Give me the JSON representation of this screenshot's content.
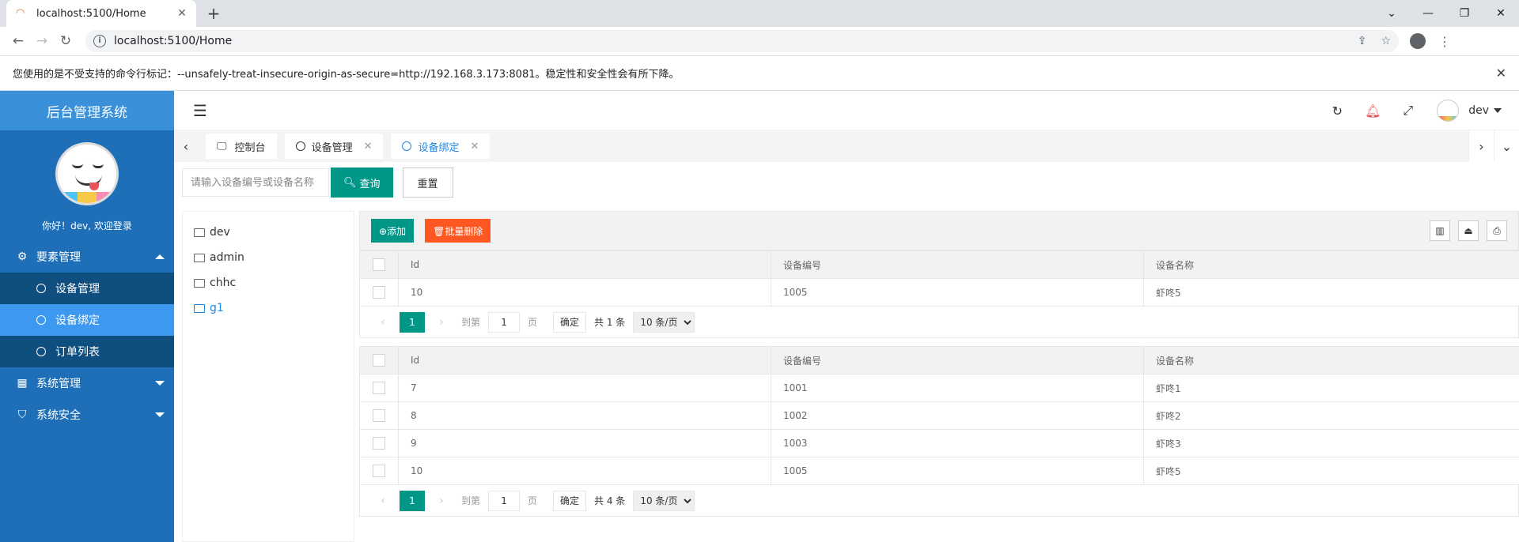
{
  "browser": {
    "tab_title": "localhost:5100/Home",
    "url": "localhost:5100/Home",
    "infobar_message": "您使用的是不受支持的命令行标记：--unsafely-treat-insecure-origin-as-secure=http://192.168.3.173:8081。稳定性和安全性会有所下降。"
  },
  "sidebar": {
    "title": "后台管理系统",
    "greeting": "你好！dev, 欢迎登录",
    "menu": [
      {
        "label": "要素管理",
        "icon": "gear-icon",
        "expanded": true,
        "children": [
          {
            "label": "设备管理",
            "active": false
          },
          {
            "label": "设备绑定",
            "active": true
          },
          {
            "label": "订单列表",
            "active": false
          }
        ]
      },
      {
        "label": "系统管理",
        "icon": "grid-icon",
        "expanded": false
      },
      {
        "label": "系统安全",
        "icon": "shield-icon",
        "expanded": false
      }
    ]
  },
  "header": {
    "username": "dev"
  },
  "page_tabs": [
    {
      "label": "控制台",
      "icon": "monitor-icon",
      "active": false,
      "closable": false
    },
    {
      "label": "设备管理",
      "icon": "circle-icon",
      "active": false,
      "closable": true
    },
    {
      "label": "设备绑定",
      "icon": "circle-icon",
      "active": true,
      "closable": true
    }
  ],
  "search": {
    "placeholder": "请输入设备编号或设备名称",
    "query_label": "查询",
    "reset_label": "重置"
  },
  "tree": {
    "nodes": [
      "dev",
      "admin",
      "chhc",
      "g1"
    ],
    "selected": "g1"
  },
  "toolbar": {
    "add_label": "添加",
    "batch_delete_label": "批量删除"
  },
  "columns": [
    "Id",
    "设备编号",
    "设备名称"
  ],
  "table1": {
    "rows": [
      [
        "10",
        "1005",
        "虾咚5"
      ]
    ],
    "pager": {
      "current": "1",
      "goto_prefix": "到第",
      "goto_value": "1",
      "goto_suffix": "页",
      "confirm": "确定",
      "total": "共 1 条",
      "page_size": "10 条/页"
    }
  },
  "table2": {
    "rows": [
      [
        "7",
        "1001",
        "虾咚1"
      ],
      [
        "8",
        "1002",
        "虾咚2"
      ],
      [
        "9",
        "1003",
        "虾咚3"
      ],
      [
        "10",
        "1005",
        "虾咚5"
      ]
    ],
    "pager": {
      "current": "1",
      "goto_prefix": "到第",
      "goto_value": "1",
      "goto_suffix": "页",
      "confirm": "确定",
      "total": "共 4 条",
      "page_size": "10 条/页"
    }
  },
  "colors": {
    "sidebar_bg": "#1e6fb8",
    "sidebar_title_bg": "#3a90d9",
    "menu_active": "#3d98ef",
    "primary_green": "#009688",
    "danger_orange": "#ff5722",
    "tab_active": "#1e88e5"
  }
}
